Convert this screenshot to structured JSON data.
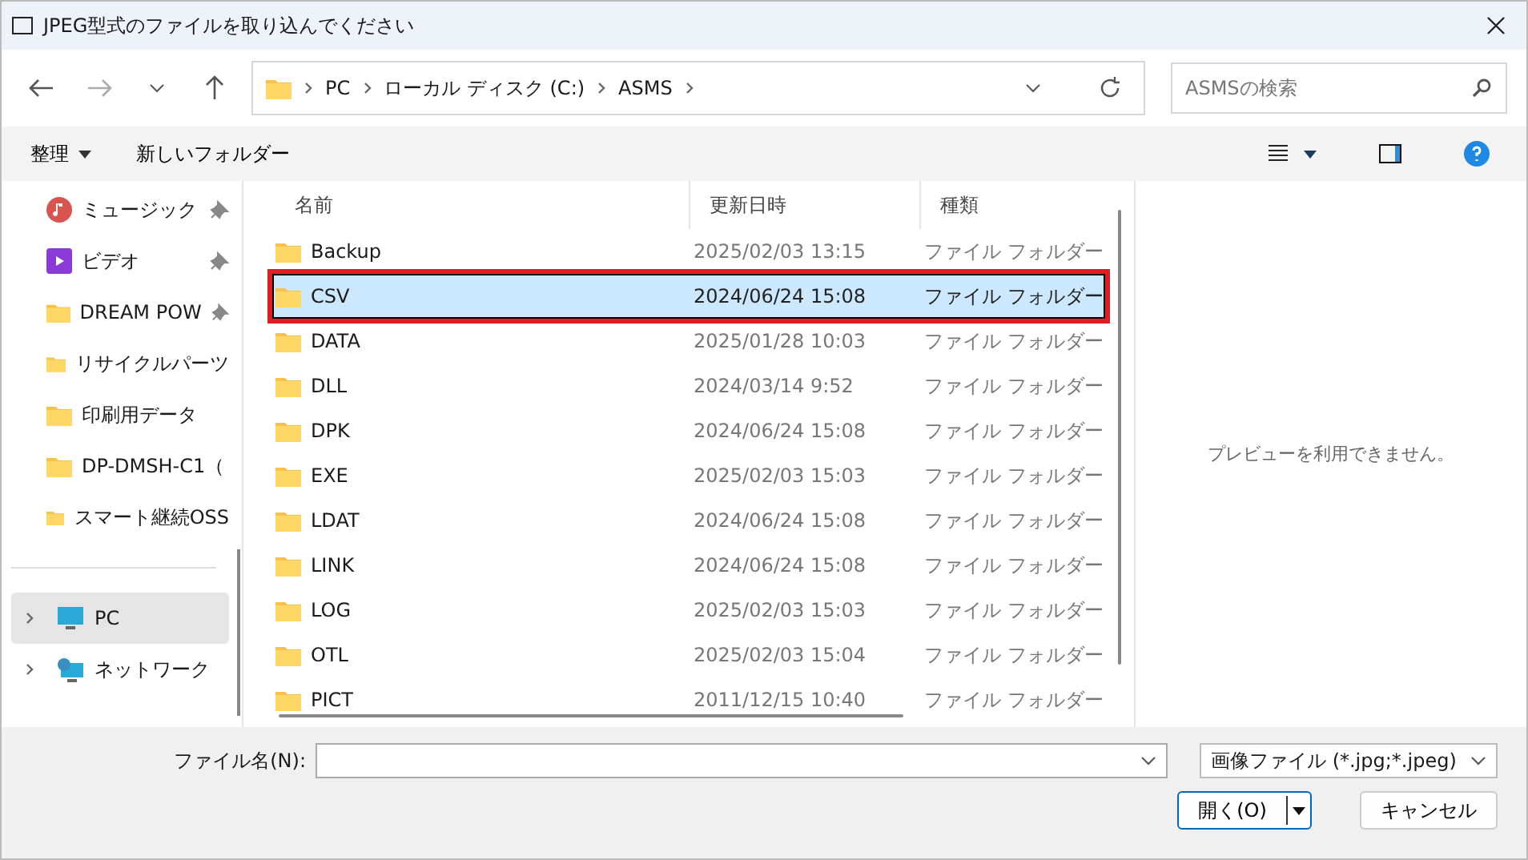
{
  "window": {
    "title": "JPEG型式のファイルを取り込んでください"
  },
  "address_bar": {
    "crumbs": [
      "PC",
      "ローカル ディスク (C:)",
      "ASMS"
    ]
  },
  "search": {
    "placeholder": "ASMSの検索"
  },
  "command_bar": {
    "organize": "整理",
    "new_folder": "新しいフォルダー"
  },
  "sidebar": {
    "items": [
      {
        "label": "ミュージック",
        "kind": "music",
        "pinned": true,
        "selected": false,
        "expandable": false
      },
      {
        "label": "ビデオ",
        "kind": "video",
        "pinned": true,
        "selected": false,
        "expandable": false
      },
      {
        "label": "DREAM POW",
        "kind": "folder",
        "pinned": true,
        "selected": false,
        "expandable": false
      },
      {
        "label": "リサイクルパーツ",
        "kind": "folder",
        "pinned": false,
        "selected": false,
        "expandable": false
      },
      {
        "label": "印刷用データ",
        "kind": "folder",
        "pinned": false,
        "selected": false,
        "expandable": false
      },
      {
        "label": "DP-DMSH-C1（",
        "kind": "folder",
        "pinned": false,
        "selected": false,
        "expandable": false
      },
      {
        "label": "スマート継続OSS",
        "kind": "folder",
        "pinned": false,
        "selected": false,
        "expandable": false
      },
      {
        "label": "PC",
        "kind": "pc",
        "pinned": false,
        "selected": true,
        "expandable": true
      },
      {
        "label": "ネットワーク",
        "kind": "network",
        "pinned": false,
        "selected": false,
        "expandable": true
      }
    ]
  },
  "table": {
    "columns": [
      "名前",
      "更新日時",
      "種類"
    ],
    "rows": [
      {
        "name": "Backup",
        "date": "2025/02/03 13:15",
        "type": "ファイル フォルダー",
        "selected": false,
        "highlighted": false
      },
      {
        "name": "CSV",
        "date": "2024/06/24 15:08",
        "type": "ファイル フォルダー",
        "selected": true,
        "highlighted": true
      },
      {
        "name": "DATA",
        "date": "2025/01/28 10:03",
        "type": "ファイル フォルダー",
        "selected": false,
        "highlighted": false
      },
      {
        "name": "DLL",
        "date": "2024/03/14 9:52",
        "type": "ファイル フォルダー",
        "selected": false,
        "highlighted": false
      },
      {
        "name": "DPK",
        "date": "2024/06/24 15:08",
        "type": "ファイル フォルダー",
        "selected": false,
        "highlighted": false
      },
      {
        "name": "EXE",
        "date": "2025/02/03 15:03",
        "type": "ファイル フォルダー",
        "selected": false,
        "highlighted": false
      },
      {
        "name": "LDAT",
        "date": "2024/06/24 15:08",
        "type": "ファイル フォルダー",
        "selected": false,
        "highlighted": false
      },
      {
        "name": "LINK",
        "date": "2024/06/24 15:08",
        "type": "ファイル フォルダー",
        "selected": false,
        "highlighted": false
      },
      {
        "name": "LOG",
        "date": "2025/02/03 15:03",
        "type": "ファイル フォルダー",
        "selected": false,
        "highlighted": false
      },
      {
        "name": "OTL",
        "date": "2025/02/03 15:04",
        "type": "ファイル フォルダー",
        "selected": false,
        "highlighted": false
      },
      {
        "name": "PICT",
        "date": "2011/12/15 10:40",
        "type": "ファイル フォルダー",
        "selected": false,
        "highlighted": false
      }
    ]
  },
  "preview": {
    "message": "プレビューを利用できません。"
  },
  "footer": {
    "filename_label": "ファイル名(N):",
    "filter": "画像ファイル (*.jpg;*.jpeg)",
    "open": "開く(O)",
    "cancel": "キャンセル"
  }
}
